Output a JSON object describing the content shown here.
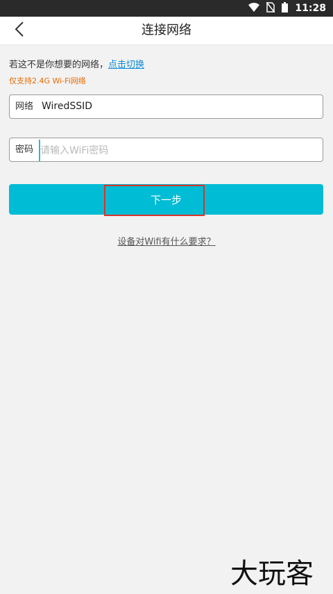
{
  "status_bar": {
    "time": "11:28",
    "icons": [
      "wifi-icon",
      "no-sim-icon",
      "battery-icon"
    ]
  },
  "header": {
    "title": "连接网络",
    "back_icon": "chevron-left-icon"
  },
  "prompt": {
    "text": "若这不是你想要的网络，",
    "link": "点击切换"
  },
  "note": "仅支持2.4G Wi-Fi网络",
  "network_field": {
    "label": "网络",
    "value": "WiredSSID"
  },
  "password_field": {
    "label": "密码",
    "placeholder": "请输入WiFi密码",
    "value": ""
  },
  "next_button": {
    "label": "下一步"
  },
  "help_link": "设备对Wifi有什么要求？",
  "watermark": {
    "text": "大玩客"
  },
  "colors": {
    "accent": "#00bcd4",
    "link": "#0a8cd7",
    "note": "#e86b00",
    "highlight": "#d9342b"
  }
}
